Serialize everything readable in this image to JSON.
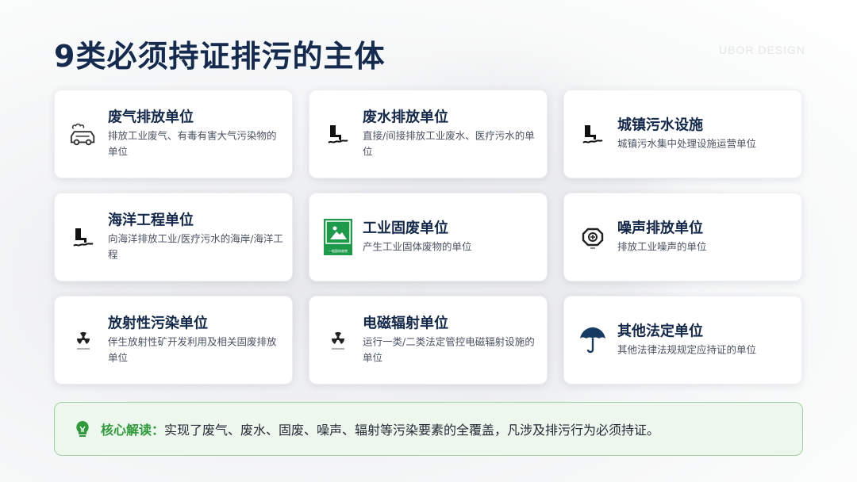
{
  "title": "9类必须持证排污的主体",
  "watermark": "UBOR DESIGN",
  "cards": [
    {
      "title": "废气排放单位",
      "desc": "排放工业废气、有毒有害大气污染物的单位",
      "icon": "car-exhaust-icon"
    },
    {
      "title": "废水排放单位",
      "desc": "直接/间接排放工业废水、医疗污水的单位",
      "icon": "wastewater-pipe-icon"
    },
    {
      "title": "城镇污水设施",
      "desc": "城镇污水集中处理设施运营单位",
      "icon": "wastewater-pipe-icon"
    },
    {
      "title": "海洋工程单位",
      "desc": "向海洋排放工业/医疗污水的海岸/海洋工程",
      "icon": "wastewater-pipe-icon"
    },
    {
      "title": "工业固废单位",
      "desc": "产生工业固体废物的单位",
      "icon": "solid-waste-sign-icon",
      "icon_caption": "一般固体废物"
    },
    {
      "title": "噪声排放单位",
      "desc": "排放工业噪声的单位",
      "icon": "noise-symbol-icon"
    },
    {
      "title": "放射性污染单位",
      "desc": "伴生放射性矿开发利用及相关固废排放单位",
      "icon": "radiation-icon"
    },
    {
      "title": "电磁辐射单位",
      "desc": "运行一类/二类法定管控电磁辐射设施的单位",
      "icon": "radiation-icon"
    },
    {
      "title": "其他法定单位",
      "desc": "其他法律法规规定应持证的单位",
      "icon": "umbrella-icon"
    }
  ],
  "banner": {
    "label": "核心解读：",
    "text": "实现了废气、废水、固废、噪声、辐射等污染要素的全覆盖，凡涉及排污行为必须持证。",
    "icon": "lightbulb-icon"
  },
  "colors": {
    "title": "#152a4f",
    "banner_green": "#2e9a3a",
    "banner_bg": "#eef7ee",
    "sign_green": "#1e9a4b"
  }
}
